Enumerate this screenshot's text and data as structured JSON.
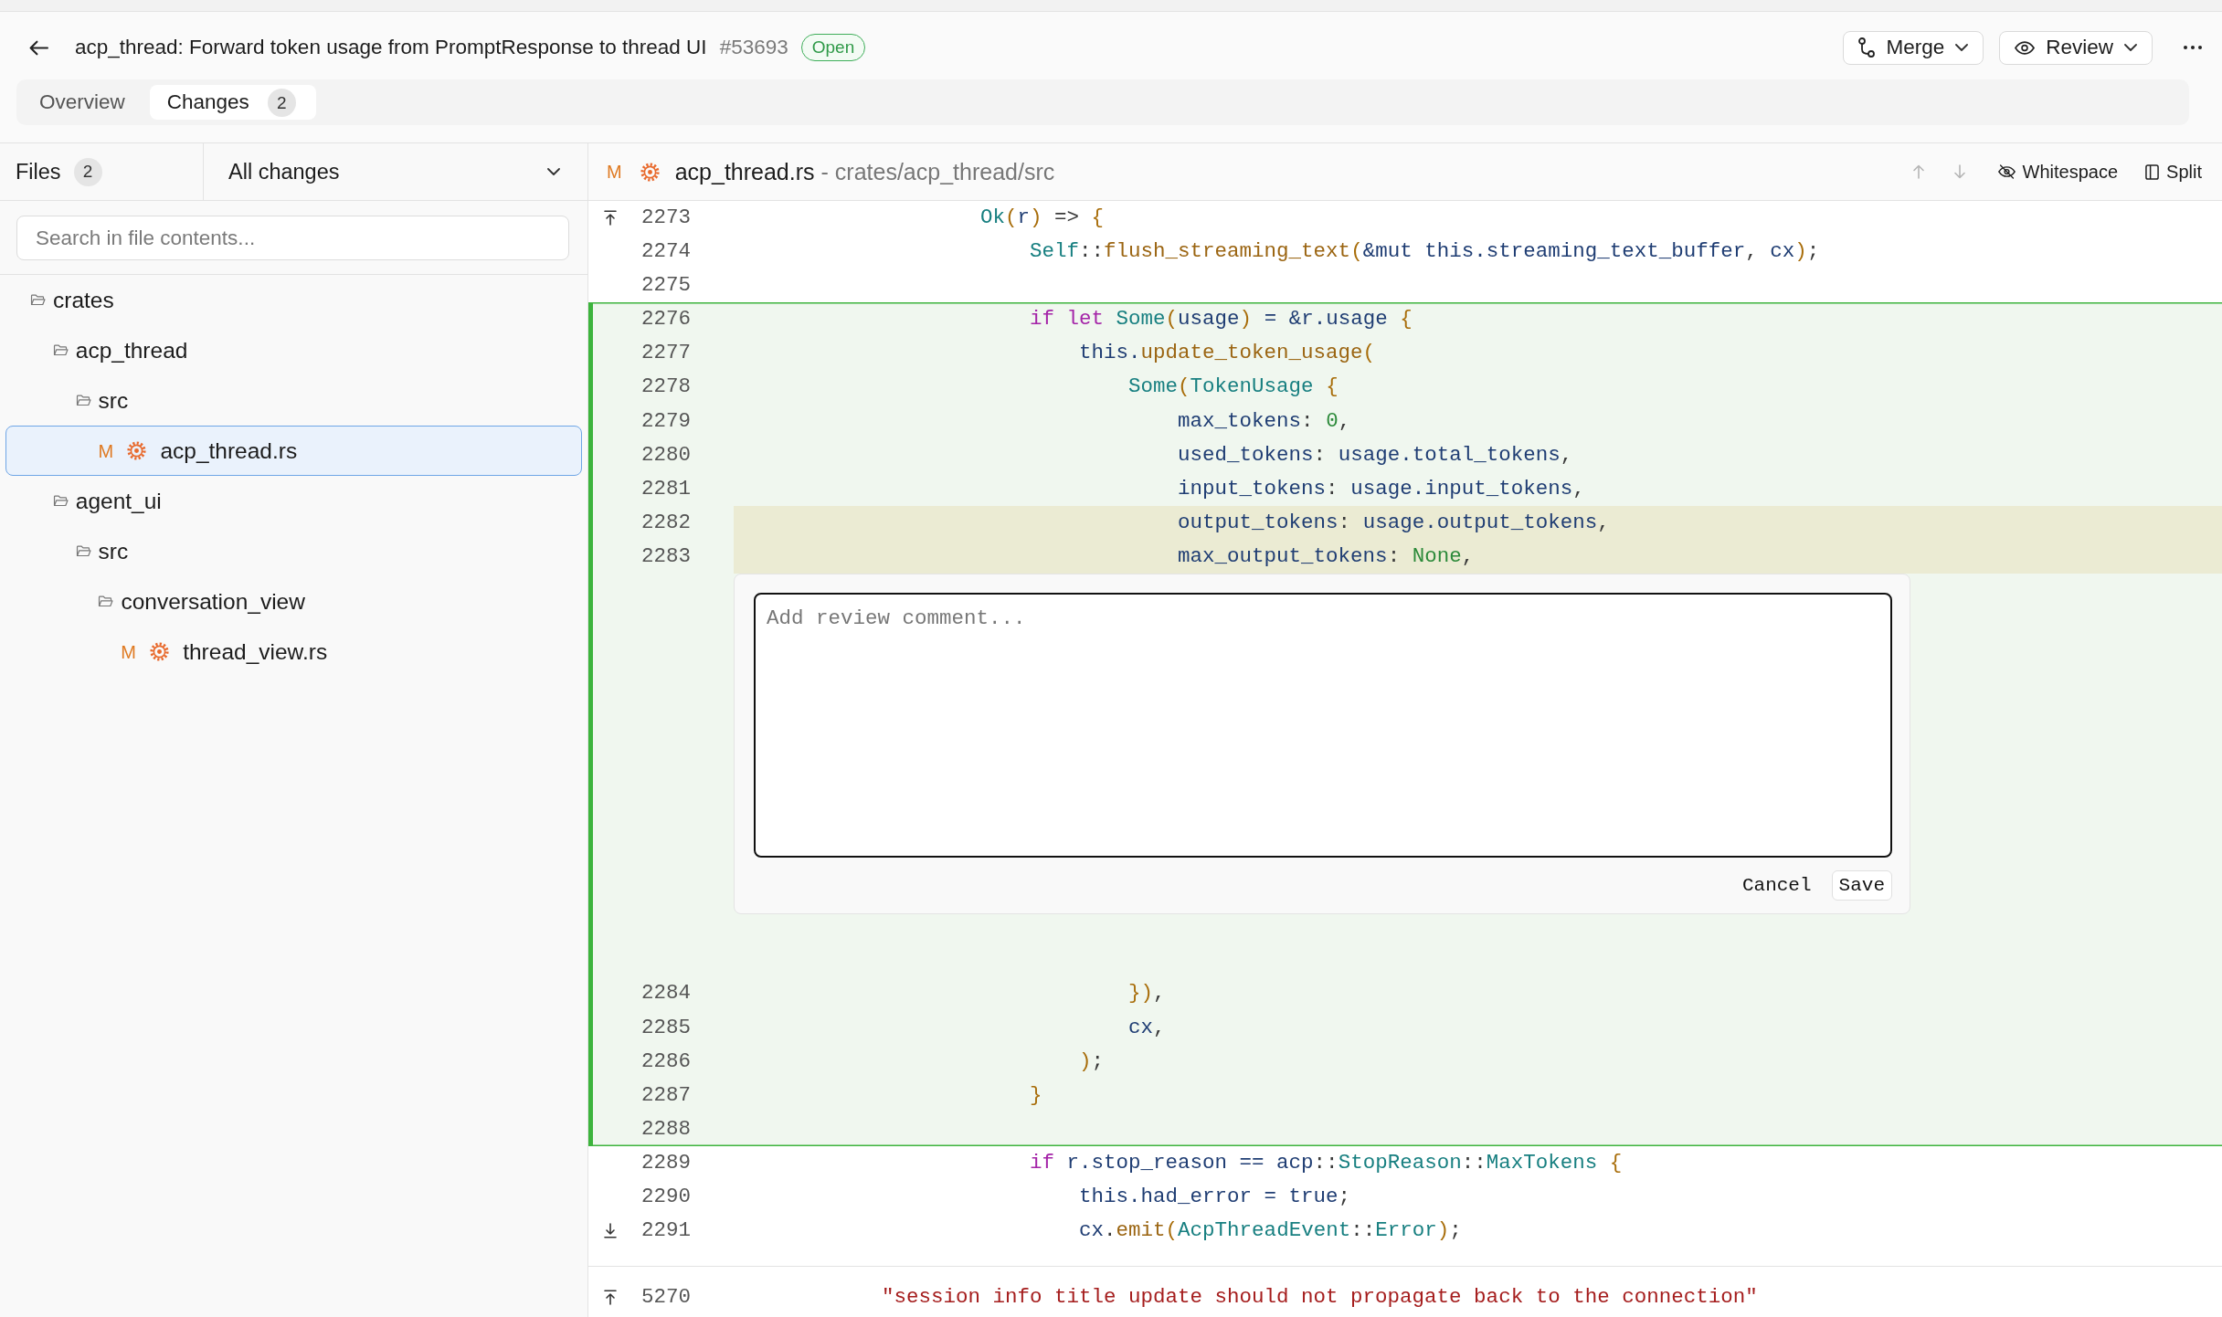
{
  "pull_request": {
    "title": "acp_thread: Forward token usage from PromptResponse to thread UI",
    "number": "#53693",
    "state": {
      "label": "Open",
      "kind": "open"
    }
  },
  "actions": [
    {
      "label": "Merge",
      "kind": "merge"
    },
    {
      "label": "Review",
      "kind": "review"
    }
  ],
  "tabs": [
    {
      "label": "Overview",
      "selected": false
    },
    {
      "label": "Changes",
      "count": "2",
      "selected": true
    }
  ],
  "sidebar": {
    "files_label": "Files",
    "file_count": "2",
    "filter": {
      "value": "All changes"
    },
    "search": {
      "placeholder": "Search in file contents..."
    },
    "tree": [
      {
        "label": "crates",
        "kind": "folder",
        "expanded": true,
        "selected": false,
        "children": [
          {
            "label": "acp_thread",
            "kind": "folder",
            "expanded": true,
            "selected": false,
            "children": [
              {
                "label": "src",
                "kind": "folder",
                "expanded": true,
                "selected": false,
                "children": [
                  {
                    "label": "acp_thread.rs",
                    "kind": "file",
                    "status": {
                      "label": "M",
                      "kind": "modified"
                    },
                    "selected": true
                  }
                ]
              }
            ]
          },
          {
            "label": "agent_ui",
            "kind": "folder",
            "expanded": true,
            "selected": false,
            "children": [
              {
                "label": "src",
                "kind": "folder",
                "expanded": true,
                "selected": false,
                "children": [
                  {
                    "label": "conversation_view",
                    "kind": "folder",
                    "expanded": true,
                    "selected": false,
                    "children": [
                      {
                        "label": "thread_view.rs",
                        "kind": "file",
                        "status": {
                          "label": "M",
                          "kind": "modified"
                        },
                        "selected": false
                      }
                    ]
                  }
                ]
              }
            ]
          }
        ]
      }
    ]
  },
  "file_header": {
    "status": {
      "label": "M",
      "kind": "modified"
    },
    "filename": "acp_thread.rs",
    "path": "- crates/acp_thread/src",
    "tools": [
      {
        "label": "Whitespace",
        "kind": "whitespace"
      },
      {
        "label": "Split",
        "kind": "split"
      }
    ]
  },
  "diff": {
    "sections": [
      {
        "segments": [
          {
            "kind": "context",
            "rows": [
              {
                "kind": "code",
                "number": "2273",
                "expand_above": true,
                "selected": false,
                "tokens": [
                  {
                    "text": "                    Ok",
                    "kind": "type"
                  },
                  {
                    "text": "(",
                    "kind": "bracket"
                  },
                  {
                    "text": "r",
                    "kind": "identifier"
                  },
                  {
                    "text": ")",
                    "kind": "bracket"
                  },
                  {
                    "text": " => ",
                    "kind": "plain"
                  },
                  {
                    "text": "{",
                    "kind": "bracket"
                  }
                ]
              },
              {
                "kind": "code",
                "number": "2274",
                "selected": false,
                "tokens": [
                  {
                    "text": "                        Self",
                    "kind": "type"
                  },
                  {
                    "text": "::",
                    "kind": "plain"
                  },
                  {
                    "text": "flush_streaming_text",
                    "kind": "function"
                  },
                  {
                    "text": "(",
                    "kind": "bracket"
                  },
                  {
                    "text": "&mut this.streaming_text_buffer",
                    "kind": "identifier"
                  },
                  {
                    "text": ", ",
                    "kind": "plain"
                  },
                  {
                    "text": "cx",
                    "kind": "identifier"
                  },
                  {
                    "text": ")",
                    "kind": "bracket"
                  },
                  {
                    "text": ";",
                    "kind": "plain"
                  }
                ]
              },
              {
                "kind": "code",
                "number": "2275",
                "selected": false
              }
            ]
          },
          {
            "kind": "added",
            "rows": [
              {
                "kind": "code",
                "number": "2276",
                "selected": false,
                "tokens": [
                  {
                    "text": "                        if let ",
                    "kind": "keyword"
                  },
                  {
                    "text": "Some",
                    "kind": "type"
                  },
                  {
                    "text": "(",
                    "kind": "bracket"
                  },
                  {
                    "text": "usage",
                    "kind": "identifier"
                  },
                  {
                    "text": ")",
                    "kind": "bracket"
                  },
                  {
                    "text": " = &r.usage ",
                    "kind": "identifier"
                  },
                  {
                    "text": "{",
                    "kind": "bracket"
                  }
                ]
              },
              {
                "kind": "code",
                "number": "2277",
                "selected": false,
                "tokens": [
                  {
                    "text": "                            this.",
                    "kind": "identifier"
                  },
                  {
                    "text": "update_token_usage",
                    "kind": "function"
                  },
                  {
                    "text": "(",
                    "kind": "bracket"
                  }
                ]
              },
              {
                "kind": "code",
                "number": "2278",
                "selected": false,
                "tokens": [
                  {
                    "text": "                                Some",
                    "kind": "type"
                  },
                  {
                    "text": "(",
                    "kind": "bracket"
                  },
                  {
                    "text": "TokenUsage ",
                    "kind": "type"
                  },
                  {
                    "text": "{",
                    "kind": "bracket"
                  }
                ]
              },
              {
                "kind": "code",
                "number": "2279",
                "selected": false,
                "tokens": [
                  {
                    "text": "                                    max_tokens",
                    "kind": "identifier"
                  },
                  {
                    "text": ": ",
                    "kind": "plain"
                  },
                  {
                    "text": "0",
                    "kind": "literal"
                  },
                  {
                    "text": ",",
                    "kind": "plain"
                  }
                ]
              },
              {
                "kind": "code",
                "number": "2280",
                "selected": false,
                "tokens": [
                  {
                    "text": "                                    used_tokens",
                    "kind": "identifier"
                  },
                  {
                    "text": ": ",
                    "kind": "plain"
                  },
                  {
                    "text": "usage.total_tokens",
                    "kind": "identifier"
                  },
                  {
                    "text": ",",
                    "kind": "plain"
                  }
                ]
              },
              {
                "kind": "code",
                "number": "2281",
                "selected": false,
                "tokens": [
                  {
                    "text": "                                    input_tokens",
                    "kind": "identifier"
                  },
                  {
                    "text": ": ",
                    "kind": "plain"
                  },
                  {
                    "text": "usage.input_tokens",
                    "kind": "identifier"
                  },
                  {
                    "text": ",",
                    "kind": "plain"
                  }
                ]
              },
              {
                "kind": "code",
                "number": "2282",
                "selected": true,
                "tokens": [
                  {
                    "text": "                                    output_tokens",
                    "kind": "identifier"
                  },
                  {
                    "text": ": ",
                    "kind": "plain"
                  },
                  {
                    "text": "usage.output_tokens",
                    "kind": "identifier"
                  },
                  {
                    "text": ",",
                    "kind": "plain"
                  }
                ]
              },
              {
                "kind": "code",
                "number": "2283",
                "selected": true,
                "tokens": [
                  {
                    "text": "                                    max_output_tokens",
                    "kind": "identifier"
                  },
                  {
                    "text": ": ",
                    "kind": "plain"
                  },
                  {
                    "text": "None",
                    "kind": "literal"
                  },
                  {
                    "text": ",",
                    "kind": "plain"
                  }
                ]
              },
              {
                "kind": "comment_editor",
                "placeholder": "Add review comment...",
                "buttons": [
                  {
                    "label": "Cancel",
                    "kind": "cancel"
                  },
                  {
                    "label": "Save",
                    "kind": "save"
                  }
                ]
              },
              {
                "kind": "code",
                "number": "2284",
                "selected": false,
                "tokens": [
                  {
                    "text": "                                })",
                    "kind": "bracket"
                  },
                  {
                    "text": ",",
                    "kind": "plain"
                  }
                ]
              },
              {
                "kind": "code",
                "number": "2285",
                "selected": false,
                "tokens": [
                  {
                    "text": "                                cx",
                    "kind": "identifier"
                  },
                  {
                    "text": ",",
                    "kind": "plain"
                  }
                ]
              },
              {
                "kind": "code",
                "number": "2286",
                "selected": false,
                "tokens": [
                  {
                    "text": "                            )",
                    "kind": "bracket"
                  },
                  {
                    "text": ";",
                    "kind": "plain"
                  }
                ]
              },
              {
                "kind": "code",
                "number": "2287",
                "selected": false,
                "tokens": [
                  {
                    "text": "                        }",
                    "kind": "bracket"
                  }
                ]
              },
              {
                "kind": "code",
                "number": "2288",
                "selected": false
              }
            ]
          },
          {
            "kind": "context",
            "rows": [
              {
                "kind": "code",
                "number": "2289",
                "selected": false,
                "tokens": [
                  {
                    "text": "                        if",
                    "kind": "keyword"
                  },
                  {
                    "text": " r.stop_reason == acp",
                    "kind": "identifier"
                  },
                  {
                    "text": "::",
                    "kind": "plain"
                  },
                  {
                    "text": "StopReason",
                    "kind": "type"
                  },
                  {
                    "text": "::",
                    "kind": "plain"
                  },
                  {
                    "text": "MaxTokens ",
                    "kind": "type"
                  },
                  {
                    "text": "{",
                    "kind": "bracket"
                  }
                ]
              },
              {
                "kind": "code",
                "number": "2290",
                "selected": false,
                "tokens": [
                  {
                    "text": "                            this.had_error = true",
                    "kind": "identifier"
                  },
                  {
                    "text": ";",
                    "kind": "plain"
                  }
                ]
              },
              {
                "kind": "code",
                "number": "2291",
                "expand_below": true,
                "selected": false,
                "tokens": [
                  {
                    "text": "                            cx",
                    "kind": "identifier"
                  },
                  {
                    "text": ".",
                    "kind": "plain"
                  },
                  {
                    "text": "emit",
                    "kind": "function"
                  },
                  {
                    "text": "(",
                    "kind": "bracket"
                  },
                  {
                    "text": "AcpThreadEvent",
                    "kind": "type"
                  },
                  {
                    "text": "::",
                    "kind": "plain"
                  },
                  {
                    "text": "Error",
                    "kind": "type"
                  },
                  {
                    "text": ")",
                    "kind": "bracket"
                  },
                  {
                    "text": ";",
                    "kind": "plain"
                  }
                ]
              }
            ]
          }
        ]
      },
      {
        "segments": [
          {
            "kind": "context",
            "rows": [
              {
                "kind": "code",
                "number": "5270",
                "expand_above": true,
                "selected": false,
                "tokens": [
                  {
                    "text": "            \"session info title update should not propagate back to the connection\"",
                    "kind": "string"
                  }
                ]
              }
            ]
          }
        ]
      }
    ]
  }
}
